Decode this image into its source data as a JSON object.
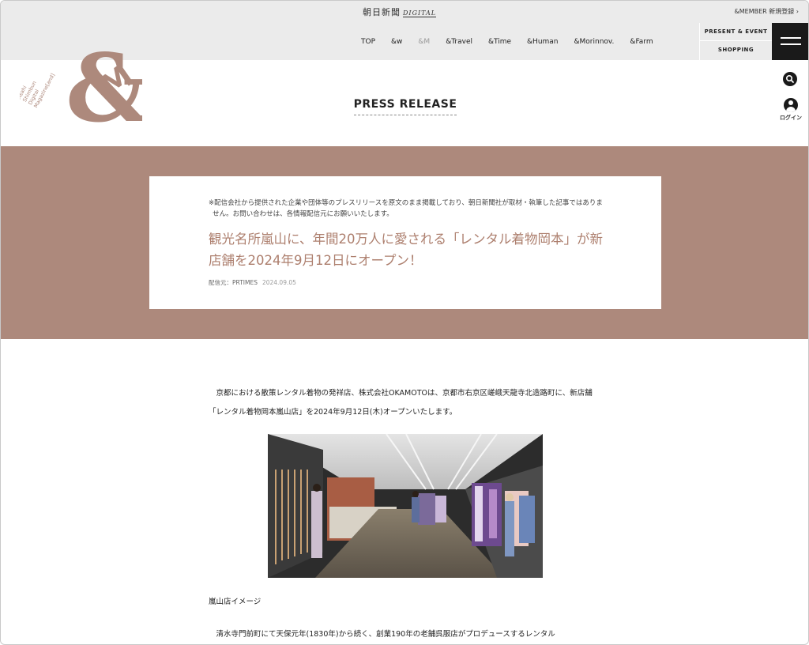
{
  "topbar": {
    "brand": "朝日新聞",
    "brand_sub": "DIGITAL",
    "member_link": "&MEMBER 新規登録 ›"
  },
  "nav": {
    "items": [
      {
        "label": "TOP"
      },
      {
        "label": "&w"
      },
      {
        "label": "&M"
      },
      {
        "label": "&Travel"
      },
      {
        "label": "&Time"
      },
      {
        "label": "&Human"
      },
      {
        "label": "&Morinnov."
      },
      {
        "label": "&Farm"
      }
    ],
    "present_event": "PRESENT & EVENT",
    "shopping": "SHOPPING"
  },
  "logo": {
    "mark": "&M",
    "side_text": "Asahi Shimbun Digital Magazine[and]"
  },
  "icons": {
    "search": "search-icon",
    "login": "user-icon",
    "login_label": "ログイン"
  },
  "page_title": "PRESS RELEASE",
  "colors": {
    "hero_bg": "#ad897c",
    "headline": "#ad7f6e",
    "nav_bg": "#ebebeb",
    "menu_bg": "#1a1a1a"
  },
  "release": {
    "notice": "※配信会社から提供された企業や団体等のプレスリリースを原文のまま掲載しており、朝日新聞社が取材・執筆した記事ではありません。お問い合わせは、各情報配信元にお願いいたします。",
    "headline": "観光名所嵐山に、年間20万人に愛される「レンタル着物岡本」が新店舗を2024年9月12日にオープン！",
    "source_label": "配信元：PRTIMES",
    "date": "2024.09.05"
  },
  "article": {
    "paragraph1": "　京都における散策レンタル着物の発祥店、株式会社OKAMOTOは、京都市右京区嵯峨天龍寺北造路町に、新店舗「レンタル着物岡本嵐山店」を2024年9月12日(木)オープンいたします。",
    "image_caption": "嵐山店イメージ",
    "paragraph2": "　清水寺門前町にて天保元年(1830年)から続く、創業190年の老舗呉服店がプロデュースするレンタル"
  }
}
